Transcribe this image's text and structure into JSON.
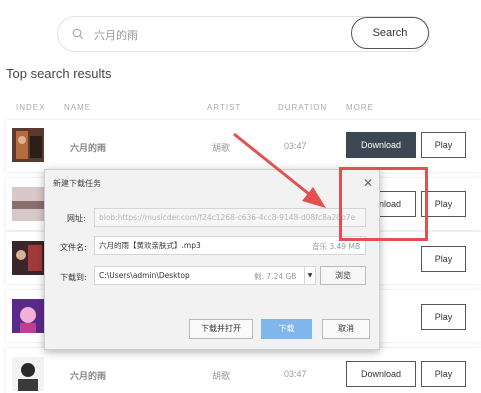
{
  "search": {
    "query": "六月的雨",
    "button_label": "Search"
  },
  "heading": "Top search results",
  "columns": {
    "index": "INDEX",
    "name": "NAME",
    "artist": "ARTIST",
    "duration": "DURATION",
    "more": "MORE"
  },
  "rows": [
    {
      "title": "六月的雨",
      "artist": "胡歌",
      "duration": "03:47",
      "download_label": "Download",
      "play_label": "Play"
    },
    {
      "download_label": "Download",
      "play_label": "Play"
    },
    {
      "play_label": "Play"
    },
    {
      "play_label": "Play"
    },
    {
      "title": "六月的雨",
      "artist": "胡歌",
      "duration": "03:47",
      "download_label": "Download",
      "play_label": "Play"
    }
  ],
  "dialog": {
    "title": "新建下载任务",
    "url_label": "网址:",
    "url_value": "blob:https://musicder.com/f24c1268-c636-4cc8-9148-d08fc8a20b7e",
    "filename_label": "文件名:",
    "filename_value": "六月的雨【黄欢亲肤式】.mp3",
    "file_meta": "音乐 3.49 MB",
    "save_label": "下载到:",
    "save_path": "C:\\Users\\admin\\Desktop",
    "disk_free": "剩: 7.24 GB",
    "browse_label": "浏览",
    "open_after_label": "下载并打开",
    "download_label": "下载",
    "cancel_label": "取消"
  },
  "colors": {
    "annotation_red": "#e35050",
    "primary_download": "#3d4653",
    "dialog_primary": "#7fb6ec"
  }
}
